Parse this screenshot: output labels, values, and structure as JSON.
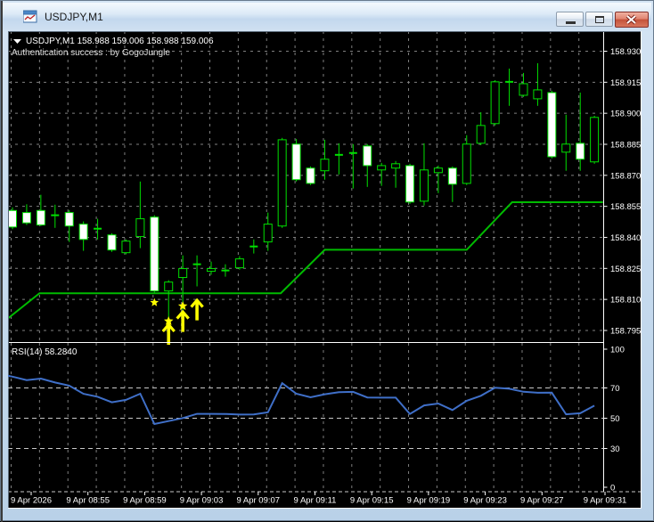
{
  "window": {
    "title": "USDJPY,M1",
    "controls": {
      "minimize": "minimize",
      "restore": "restore",
      "close": "close"
    }
  },
  "quote_line": {
    "symbol": "USDJPY,M1",
    "ohlc_text": "158.988 159.006 158.988 159.006"
  },
  "comment": "Authentication success : by GogoJungle",
  "colors": {
    "background": "#000000",
    "foreground": "#FFFFFF",
    "grid": "#7f7f7f",
    "level": "#c8c8c8",
    "candle_outline": "#00e000",
    "bull_fill": "#000000",
    "bear_fill": "#ffffff",
    "step_line": "#00bb00",
    "rsi_line": "#3f6fc8",
    "marker": "#ffff00"
  },
  "chart_data": {
    "type": "candlestick",
    "symbol": "USDJPY,M1",
    "timeframe": "M1",
    "price_axis": {
      "ticks": [
        "158.930",
        "158.915",
        "158.900",
        "158.885",
        "158.870",
        "158.855",
        "158.840",
        "158.825",
        "158.810",
        "158.795"
      ]
    },
    "time_axis": {
      "labels": [
        "9 Apr 2026",
        "9 Apr 08:55",
        "9 Apr 08:59",
        "9 Apr 09:03",
        "9 Apr 09:07",
        "9 Apr 09:11",
        "9 Apr 09:15",
        "9 Apr 09:19",
        "9 Apr 09:23",
        "9 Apr 09:27",
        "9 Apr 09:31"
      ]
    },
    "candles": [
      {
        "o": 158.853,
        "h": 158.8545,
        "l": 158.844,
        "c": 158.845
      },
      {
        "o": 158.852,
        "h": 158.856,
        "l": 158.846,
        "c": 158.847
      },
      {
        "o": 158.853,
        "h": 158.8606,
        "l": 158.8455,
        "c": 158.846
      },
      {
        "o": 158.8507,
        "h": 158.8558,
        "l": 158.8446,
        "c": 158.8507
      },
      {
        "o": 158.852,
        "h": 158.8532,
        "l": 158.8378,
        "c": 158.8455
      },
      {
        "o": 158.8464,
        "h": 158.8477,
        "l": 158.8335,
        "c": 158.839
      },
      {
        "o": 158.8442,
        "h": 158.849,
        "l": 158.839,
        "c": 158.8442
      },
      {
        "o": 158.8412,
        "h": 158.842,
        "l": 158.833,
        "c": 158.8339
      },
      {
        "o": 158.8326,
        "h": 158.839,
        "l": 158.8318,
        "c": 158.8382
      },
      {
        "o": 158.8404,
        "h": 158.867,
        "l": 158.8348,
        "c": 158.849
      },
      {
        "o": 158.8498,
        "h": 158.8507,
        "l": 158.8133,
        "c": 158.8141
      },
      {
        "o": 158.8141,
        "h": 158.8193,
        "l": 158.8004,
        "c": 158.8184
      },
      {
        "o": 158.8206,
        "h": 158.8313,
        "l": 158.8047,
        "c": 158.8249
      },
      {
        "o": 158.827,
        "h": 158.8313,
        "l": 158.8163,
        "c": 158.827
      },
      {
        "o": 158.8236,
        "h": 158.8283,
        "l": 158.8219,
        "c": 158.8249
      },
      {
        "o": 158.824,
        "h": 158.827,
        "l": 158.821,
        "c": 158.824
      },
      {
        "o": 158.8253,
        "h": 158.8309,
        "l": 158.8244,
        "c": 158.8296
      },
      {
        "o": 158.8356,
        "h": 158.839,
        "l": 158.8322,
        "c": 158.8356
      },
      {
        "o": 158.8378,
        "h": 158.852,
        "l": 158.8335,
        "c": 158.8464
      },
      {
        "o": 158.8455,
        "h": 158.8881,
        "l": 158.8446,
        "c": 158.8872
      },
      {
        "o": 158.8851,
        "h": 158.8876,
        "l": 158.867,
        "c": 158.8679
      },
      {
        "o": 158.8735,
        "h": 158.8743,
        "l": 158.8653,
        "c": 158.8661
      },
      {
        "o": 158.8722,
        "h": 158.8872,
        "l": 158.8679,
        "c": 158.8778
      },
      {
        "o": 158.8799,
        "h": 158.8855,
        "l": 158.8704,
        "c": 158.8799
      },
      {
        "o": 158.8808,
        "h": 158.8851,
        "l": 158.8636,
        "c": 158.8808
      },
      {
        "o": 158.8842,
        "h": 158.8851,
        "l": 158.8644,
        "c": 158.8747
      },
      {
        "o": 158.8726,
        "h": 158.876,
        "l": 158.8649,
        "c": 158.8747
      },
      {
        "o": 158.8735,
        "h": 158.8769,
        "l": 158.864,
        "c": 158.8756
      },
      {
        "o": 158.8747,
        "h": 158.8756,
        "l": 158.8562,
        "c": 158.8571
      },
      {
        "o": 158.8575,
        "h": 158.8855,
        "l": 158.8554,
        "c": 158.8726
      },
      {
        "o": 158.8713,
        "h": 158.8747,
        "l": 158.8614,
        "c": 158.8735
      },
      {
        "o": 158.8735,
        "h": 158.8743,
        "l": 158.8571,
        "c": 158.8657
      },
      {
        "o": 158.8661,
        "h": 158.8894,
        "l": 158.8653,
        "c": 158.8851
      },
      {
        "o": 158.8855,
        "h": 158.9005,
        "l": 158.8846,
        "c": 158.8941
      },
      {
        "o": 158.895,
        "h": 158.916,
        "l": 158.8941,
        "c": 158.9152
      },
      {
        "o": 158.9152,
        "h": 158.9216,
        "l": 158.9036,
        "c": 158.9152
      },
      {
        "o": 158.9087,
        "h": 158.9195,
        "l": 158.9079,
        "c": 158.9143
      },
      {
        "o": 158.907,
        "h": 158.9242,
        "l": 158.9036,
        "c": 158.9113
      },
      {
        "o": 158.91,
        "h": 158.9109,
        "l": 158.8782,
        "c": 158.879
      },
      {
        "o": 158.8812,
        "h": 158.8993,
        "l": 158.8722,
        "c": 158.8851
      },
      {
        "o": 158.8855,
        "h": 158.91,
        "l": 158.8722,
        "c": 158.8778
      },
      {
        "o": 158.8765,
        "h": 158.8988,
        "l": 158.8756,
        "c": 158.898
      }
    ],
    "step_line": [
      {
        "i": -1.2,
        "p": 158.796
      },
      {
        "i": 1.9,
        "p": 158.813
      },
      {
        "i": 18.9,
        "p": 158.813
      },
      {
        "i": 22.0,
        "p": 158.834
      },
      {
        "i": 32.0,
        "p": 158.834
      },
      {
        "i": 35.2,
        "p": 158.857
      },
      {
        "i": 41.6,
        "p": 158.857
      }
    ],
    "markers": [
      {
        "type": "star",
        "i": 10,
        "p": 158.8085,
        "size": 5
      },
      {
        "type": "star",
        "i": 11,
        "p": 158.7995,
        "size": 5.5
      },
      {
        "type": "arrow-up",
        "i": 11,
        "p": 158.798
      },
      {
        "type": "star",
        "i": 12,
        "p": 158.8068,
        "size": 5.5
      },
      {
        "type": "arrow-up",
        "i": 12,
        "p": 158.8042
      },
      {
        "type": "arrow-up",
        "i": 13,
        "p": 158.8098
      }
    ],
    "rsi": {
      "label": "RSI(14) 58.2840",
      "period": 14,
      "current": 58.284,
      "levels": [
        70,
        50,
        30
      ],
      "scale_labels": [
        "100",
        "70",
        "50",
        "30",
        "0"
      ],
      "values": [
        77.5,
        75.2,
        76.2,
        73.6,
        71.5,
        66.1,
        64.2,
        60.5,
        62.1,
        66.2,
        46.2,
        48.1,
        50.1,
        52.9,
        52.9,
        52.8,
        52.4,
        52.5,
        53.9,
        73.1,
        66.2,
        63.8,
        65.8,
        67.2,
        67.4,
        63.7,
        63.6,
        63.6,
        52.8,
        58.5,
        59.7,
        55.4,
        61.5,
        64.8,
        70.1,
        69.5,
        67.5,
        66.8,
        66.9,
        52.6,
        53.3,
        58.28
      ]
    }
  }
}
